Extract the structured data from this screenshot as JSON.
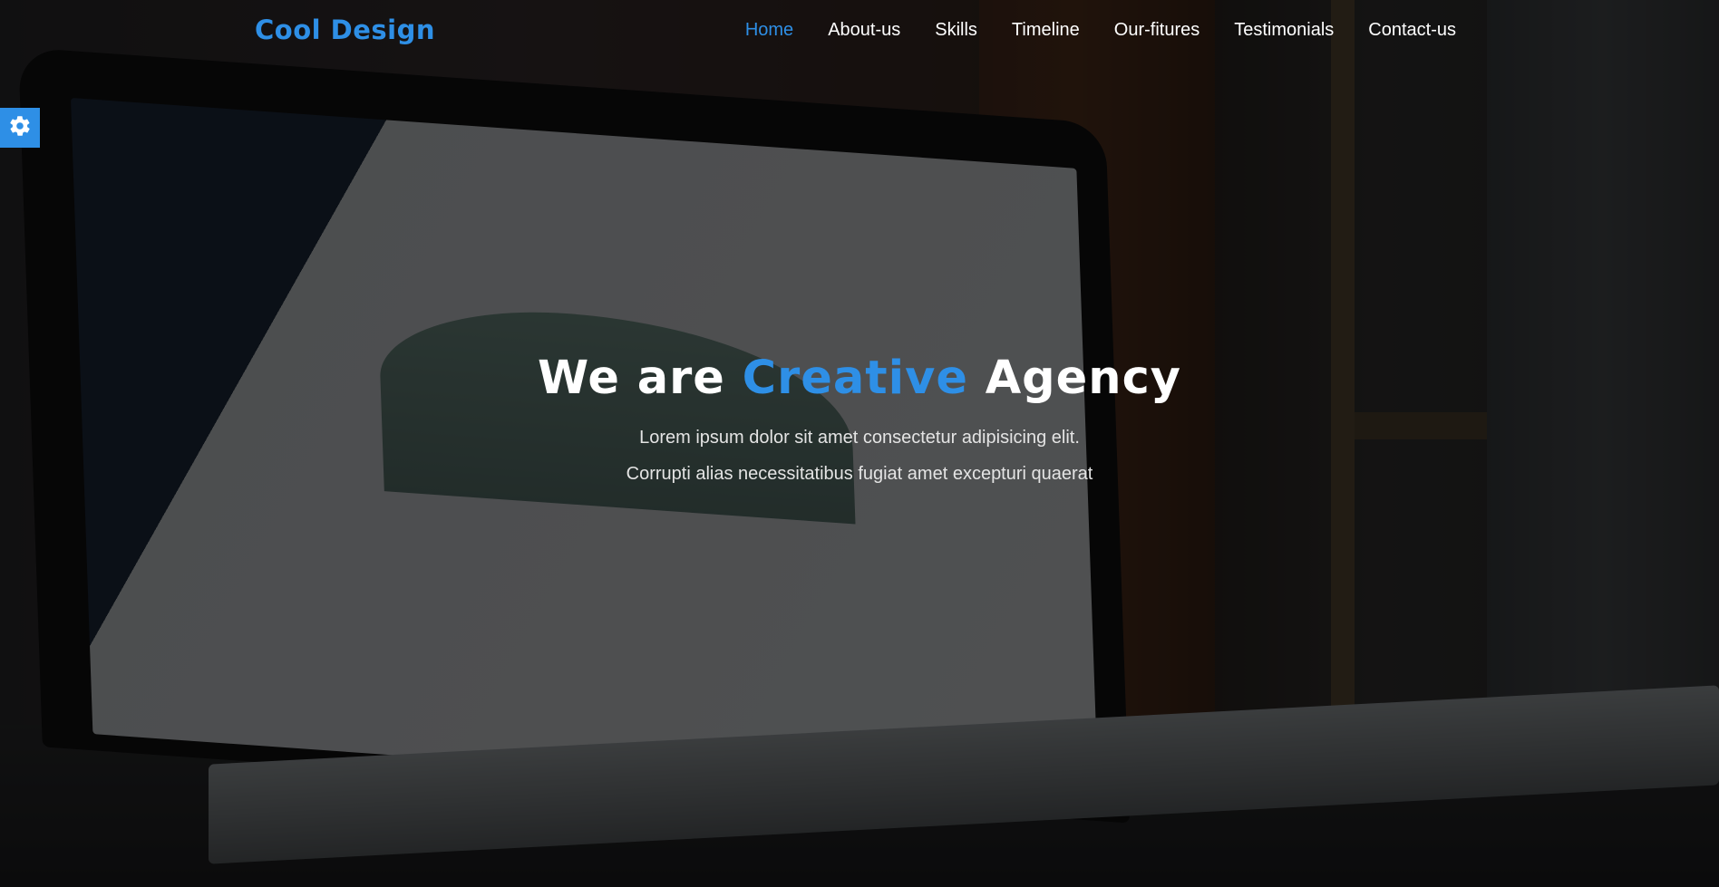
{
  "brand": {
    "logo": "Cool Design",
    "accent_color": "#2e8fe6"
  },
  "nav": {
    "items": [
      {
        "label": "Home",
        "active": true
      },
      {
        "label": "About-us",
        "active": false
      },
      {
        "label": "Skills",
        "active": false
      },
      {
        "label": "Timeline",
        "active": false
      },
      {
        "label": "Our-fitures",
        "active": false
      },
      {
        "label": "Testimonials",
        "active": false
      },
      {
        "label": "Contact-us",
        "active": false
      }
    ]
  },
  "settings": {
    "icon": "gear-icon"
  },
  "hero": {
    "title_before": "We are ",
    "title_accent": "Creative",
    "title_after": " Agency",
    "text": "Lorem ipsum dolor sit amet consectetur adipisicing elit. Corrupti alias necessitatibus fugiat amet excepturi quaerat"
  }
}
